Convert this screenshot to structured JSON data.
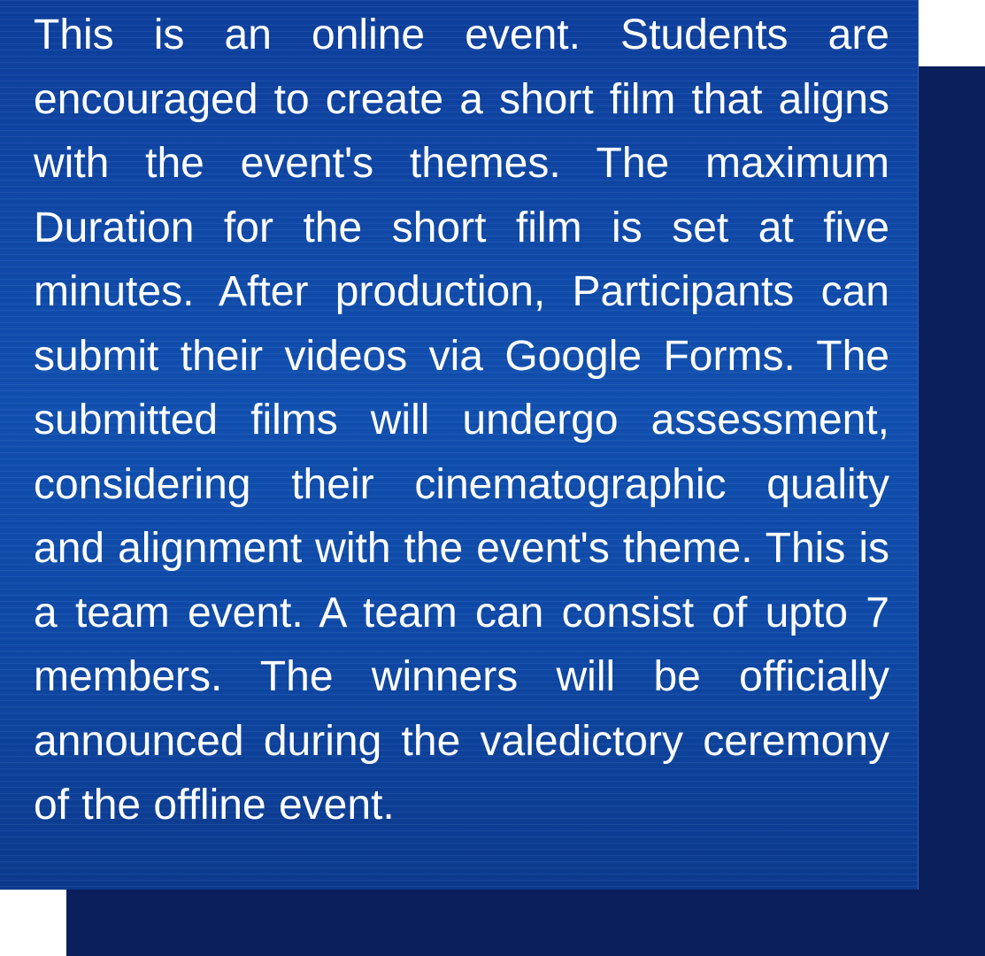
{
  "event": {
    "description": "This is an online event. Students are encouraged to create a short film that aligns with the event's themes. The maximum Duration for the short film is set at five minutes. After production, Participants can submit their videos via Google Forms. The submitted films will undergo assessment, considering their cinematographic quality and alignment with the event's theme. This is a team event. A team can consist of upto 7 members. The winners will be officially announced during the valedictory ceremony of the offline event."
  },
  "colors": {
    "card_blue": "#1150b0",
    "shadow_navy": "#0a1f5c",
    "text": "#ffffff",
    "page_background": "#ffffff"
  }
}
